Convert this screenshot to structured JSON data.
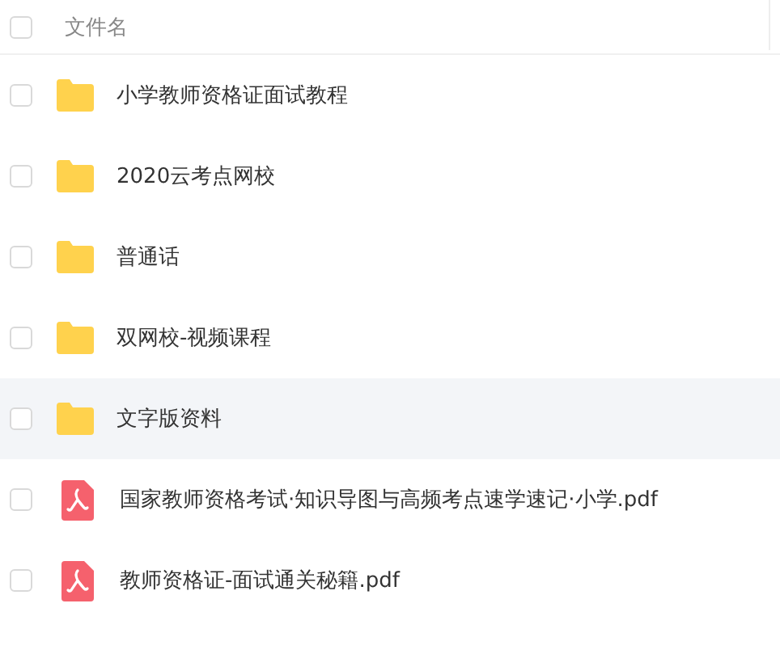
{
  "header": {
    "label": "文件名",
    "checked": false
  },
  "files": [
    {
      "kind": "folder",
      "name": "小学教师资格证面试教程",
      "checked": false,
      "highlighted": false
    },
    {
      "kind": "folder",
      "name": "2020云考点网校",
      "checked": false,
      "highlighted": false
    },
    {
      "kind": "folder",
      "name": "普通话",
      "checked": false,
      "highlighted": false
    },
    {
      "kind": "folder",
      "name": "双网校-视频课程",
      "checked": false,
      "highlighted": false
    },
    {
      "kind": "folder",
      "name": "文字版资料",
      "checked": false,
      "highlighted": true
    },
    {
      "kind": "pdf",
      "name": "国家教师资格考试·知识导图与高频考点速学速记·小学.pdf",
      "checked": false,
      "highlighted": false
    },
    {
      "kind": "pdf",
      "name": "教师资格证-面试通关秘籍.pdf",
      "checked": false,
      "highlighted": false
    }
  ]
}
